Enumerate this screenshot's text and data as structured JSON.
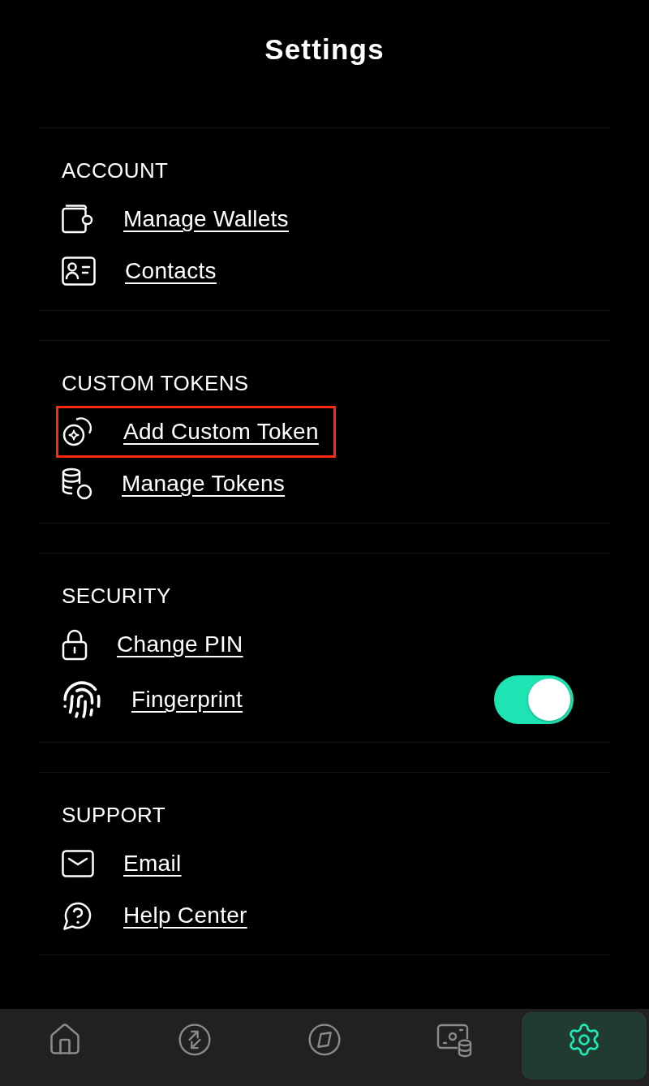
{
  "screen": {
    "title": "Settings"
  },
  "sections": [
    {
      "heading": "ACCOUNT",
      "items": [
        {
          "kind": "link",
          "label": "Manage Wallets",
          "highlighted": false
        },
        {
          "kind": "link",
          "label": "Contacts",
          "highlighted": false
        }
      ]
    },
    {
      "heading": "CUSTOM TOKENS",
      "items": [
        {
          "kind": "link",
          "label": "Add Custom Token",
          "highlighted": true
        },
        {
          "kind": "link",
          "label": "Manage Tokens",
          "highlighted": false
        }
      ]
    },
    {
      "heading": "SECURITY",
      "items": [
        {
          "kind": "link",
          "label": "Change PIN",
          "highlighted": false
        },
        {
          "kind": "toggle",
          "label": "Fingerprint",
          "on": true,
          "highlighted": false
        }
      ]
    },
    {
      "heading": "SUPPORT",
      "items": [
        {
          "kind": "link",
          "label": "Email",
          "highlighted": false
        },
        {
          "kind": "link",
          "label": "Help Center",
          "highlighted": false
        }
      ]
    }
  ],
  "bottom_nav": [
    {
      "selected": false
    },
    {
      "selected": false
    },
    {
      "selected": false
    },
    {
      "selected": false
    },
    {
      "selected": true
    }
  ]
}
